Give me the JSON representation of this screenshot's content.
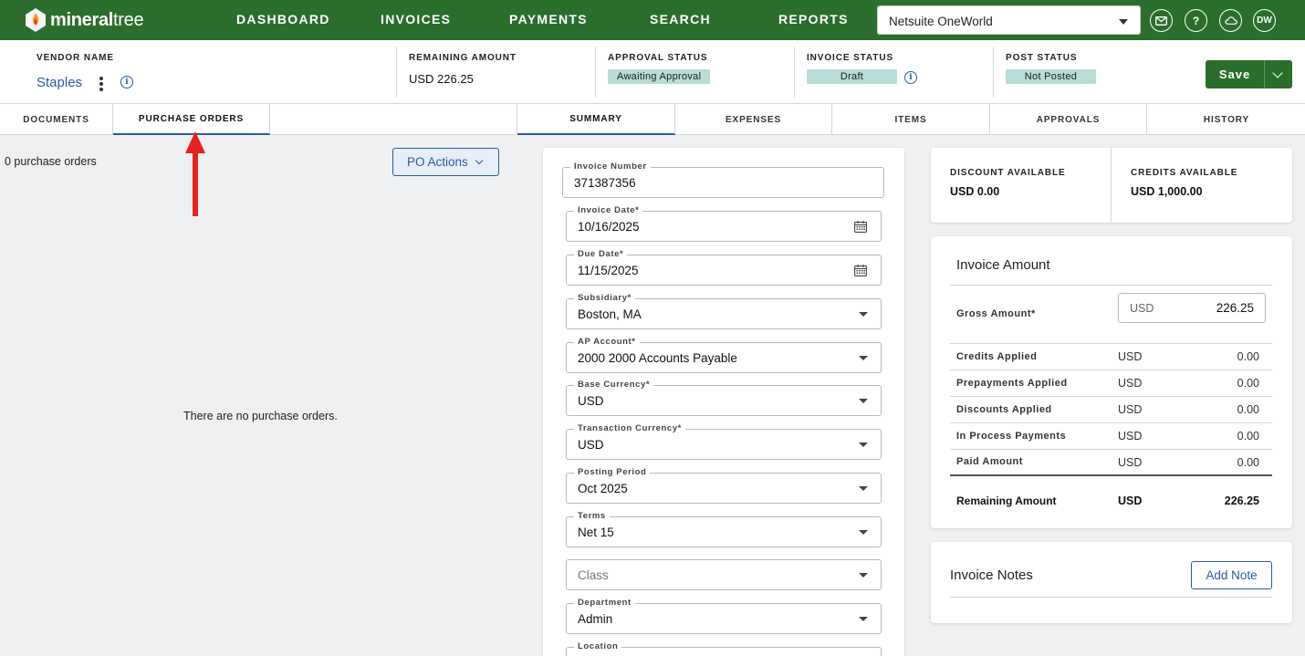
{
  "brand": {
    "logo_bold": "mineral",
    "logo_light": "tree"
  },
  "nav": {
    "items": [
      {
        "label": "DASHBOARD"
      },
      {
        "label": "INVOICES"
      },
      {
        "label": "PAYMENTS"
      },
      {
        "label": "SEARCH"
      },
      {
        "label": "REPORTS"
      }
    ],
    "org_select": "Netsuite OneWorld",
    "user_initials": "DW",
    "help_glyph": "?"
  },
  "header": {
    "vendor_label": "VENDOR NAME",
    "vendor_name": "Staples",
    "remaining_label": "REMAINING AMOUNT",
    "remaining_value": "USD  226.25",
    "approval_label": "APPROVAL STATUS",
    "approval_value": "Awaiting Approval",
    "invoice_status_label": "INVOICE STATUS",
    "invoice_status_value": "Draft",
    "post_label": "POST STATUS",
    "post_value": "Not Posted",
    "save_label": "Save"
  },
  "left_tabs": [
    {
      "label": "DOCUMENTS"
    },
    {
      "label": "PURCHASE ORDERS",
      "active": true
    }
  ],
  "right_tabs": [
    {
      "label": "SUMMARY",
      "active": true
    },
    {
      "label": "EXPENSES"
    },
    {
      "label": "ITEMS"
    },
    {
      "label": "APPROVALS"
    },
    {
      "label": "HISTORY"
    }
  ],
  "po_panel": {
    "count_text": "0 purchase orders",
    "actions_label": "PO Actions",
    "empty_text": "There are no purchase orders."
  },
  "form": {
    "invoice_number": {
      "label": "Invoice Number",
      "value": "371387356"
    },
    "invoice_date": {
      "label": "Invoice Date*",
      "value": "10/16/2025"
    },
    "due_date": {
      "label": "Due Date*",
      "value": "11/15/2025"
    },
    "subsidiary": {
      "label": "Subsidiary*",
      "value": "Boston, MA"
    },
    "ap_account": {
      "label": "AP Account*",
      "value": "2000 2000 Accounts Payable"
    },
    "base_currency": {
      "label": "Base Currency*",
      "value": "USD"
    },
    "transaction_currency": {
      "label": "Transaction Currency*",
      "value": "USD"
    },
    "posting_period": {
      "label": "Posting Period",
      "value": "Oct 2025"
    },
    "terms": {
      "label": "Terms",
      "value": "Net 15"
    },
    "class": {
      "placeholder": "Class"
    },
    "department": {
      "label": "Department",
      "value": "Admin"
    },
    "location": {
      "label": "Location"
    }
  },
  "summary": {
    "discount_label": "DISCOUNT AVAILABLE",
    "discount_value": "USD  0.00",
    "credits_label": "CREDITS AVAILABLE",
    "credits_value": "USD  1,000.00"
  },
  "invoice_amount": {
    "title": "Invoice Amount",
    "gross_label": "Gross Amount*",
    "gross_currency": "USD",
    "gross_value": "226.25",
    "rows": [
      {
        "name": "Credits Applied",
        "currency": "USD",
        "amount": "0.00"
      },
      {
        "name": "Prepayments Applied",
        "currency": "USD",
        "amount": "0.00"
      },
      {
        "name": "Discounts Applied",
        "currency": "USD",
        "amount": "0.00"
      },
      {
        "name": "In Process Payments",
        "currency": "USD",
        "amount": "0.00"
      },
      {
        "name": "Paid Amount",
        "currency": "USD",
        "amount": "0.00"
      }
    ],
    "total": {
      "name": "Remaining Amount",
      "currency": "USD",
      "amount": "226.25"
    }
  },
  "notes": {
    "title": "Invoice Notes",
    "add_label": "Add Note"
  },
  "colors": {
    "brand_green": "#2b6e2b",
    "link_blue": "#2a5d9f",
    "badge_teal": "#b7ddd6",
    "annotation_red": "#e8221c"
  }
}
